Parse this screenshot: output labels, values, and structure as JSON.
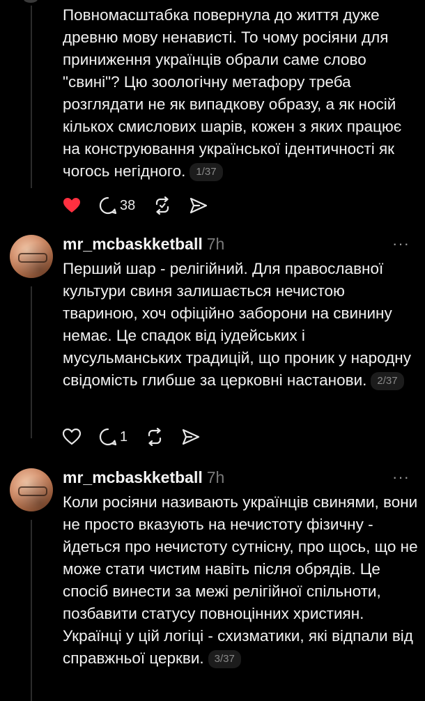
{
  "posts": [
    {
      "text": "Повномасштабка повернула до життя дуже древню мову ненависті. То чому росіяни для приниження українців обрали саме слово \"свині\"? Цю зоологічну метафору треба розглядати не як випадкову образу, а як носій кількох смислових шарів, кожен з яких працює на конструювання української ідентичності як чогось негідного.",
      "pager": "1/37",
      "liked": true,
      "replies": "38"
    },
    {
      "username": "mr_mcbaskketball",
      "time": "7h",
      "text": "Перший шар - релігійний. Для православної культури свиня залишається нечистою твариною, хоч офіційно заборони на свинину немає. Це спадок від іудейських і мусульманських традицій, що проник у народну свідомість глибше за церковні настанови.",
      "pager": "2/37",
      "liked": false,
      "replies": "1"
    },
    {
      "username": "mr_mcbaskketball",
      "time": "7h",
      "text": "Коли росіяни називають українців свинями, вони не просто вказують на нечистоту фізичну - йдеться про нечистоту сутнісну, про щось, що не може стати чистим навіть після обрядів. Це спосіб винести за межі релігійної спільноти, позбавити статусу повноцінних християн. Українці у цій логіці - схизматики, які відпали від справжньої церкви.",
      "pager": "3/37"
    }
  ],
  "icons": {
    "like": "heart-icon",
    "reply": "speech-bubble-icon",
    "repost": "repost-icon",
    "share": "paper-plane-icon",
    "more": "more-dots-icon"
  },
  "colors": {
    "background": "#000000",
    "liked": "#ff3040",
    "muted": "#7b7b7b"
  },
  "more_glyph": "···"
}
